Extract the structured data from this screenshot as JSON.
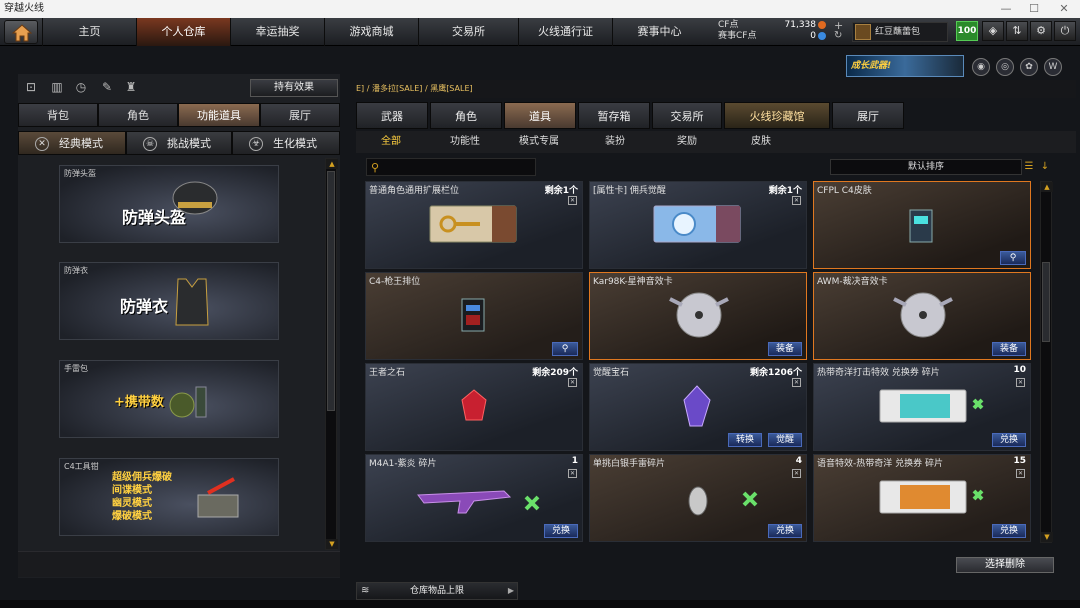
{
  "window": {
    "title": "穿越火线",
    "controls": [
      "—",
      "☐",
      "✕"
    ]
  },
  "topnav": {
    "tabs": [
      {
        "label": "主页"
      },
      {
        "label": "个人仓库"
      },
      {
        "label": "幸运抽奖"
      },
      {
        "label": "游戏商城"
      },
      {
        "label": "交易所"
      },
      {
        "label": "火线通行证"
      },
      {
        "label": "赛事中心"
      }
    ],
    "active": 1
  },
  "currency": {
    "cf_label": "CF点",
    "cf_value": "71,338",
    "event_label": "赛事CF点",
    "event_value": "0"
  },
  "pack": {
    "label": "红豆蘸蕾包"
  },
  "level": "100",
  "left": {
    "icons": [
      "box-off-icon",
      "chart-icon",
      "clock-icon",
      "tools-icon",
      "bag-icon"
    ],
    "effect_button": "持有效果",
    "tabs": [
      {
        "label": "背包"
      },
      {
        "label": "角色"
      },
      {
        "label": "功能道具"
      },
      {
        "label": "展厅"
      }
    ],
    "modes": [
      {
        "label": "经典模式"
      },
      {
        "label": "挑战模式"
      },
      {
        "label": "生化模式"
      }
    ],
    "cards": [
      {
        "tag": "防弹头盔",
        "big": "防弹头盔"
      },
      {
        "tag": "防弹衣",
        "big": "防弹衣"
      },
      {
        "tag": "手雷包",
        "big": "+携带数"
      },
      {
        "tag": "C4工具钳",
        "lines": [
          "超级佣兵爆破",
          "间谍模式",
          "幽灵模式",
          "爆破模式"
        ]
      }
    ]
  },
  "banner": {
    "text": "成长武器!"
  },
  "breadcrumb": "E] / 潘多拉[SALE] / 黑鹰[SALE]",
  "right": {
    "tabs": [
      {
        "label": "武器"
      },
      {
        "label": "角色"
      },
      {
        "label": "道具"
      },
      {
        "label": "暂存箱"
      },
      {
        "label": "交易所"
      },
      {
        "label": "火线珍藏馆"
      },
      {
        "label": "展厅"
      }
    ],
    "filters": [
      {
        "label": "全部"
      },
      {
        "label": "功能性"
      },
      {
        "label": "模式专属"
      },
      {
        "label": "装扮"
      },
      {
        "label": "奖励"
      },
      {
        "label": "皮肤"
      }
    ],
    "sort": "默认排序",
    "items": [
      {
        "name": "普通角色通用扩展栏位",
        "count": "剩余1个",
        "buttons": []
      },
      {
        "name": "[属性卡] 佣兵觉醒",
        "count": "剩余1个",
        "buttons": []
      },
      {
        "name": "CFPL C4皮肤",
        "count": "",
        "buttons": []
      },
      {
        "name": "C4-枪王排位",
        "count": "",
        "buttons": []
      },
      {
        "name": "Kar98K-星神音效卡",
        "count": "",
        "buttons": [
          "装备"
        ]
      },
      {
        "name": "AWM-裁决音效卡",
        "count": "",
        "buttons": [
          "装备"
        ]
      },
      {
        "name": "王者之石",
        "count": "剩余209个",
        "buttons": []
      },
      {
        "name": "觉醒宝石",
        "count": "剩余1206个",
        "buttons": [
          "转换",
          "觉醒"
        ]
      },
      {
        "name": "热带奇洋打击特效 兑换券 碎片",
        "count": "10",
        "buttons": [
          "兑换"
        ]
      },
      {
        "name": "M4A1-紫炎 碎片",
        "count": "1",
        "buttons": [
          "兑换"
        ]
      },
      {
        "name": "单挑白银手雷碎片",
        "count": "4",
        "buttons": [
          "兑换"
        ]
      },
      {
        "name": "语音特效-热带奇洋 兑换券 碎片",
        "count": "15",
        "buttons": [
          "兑换"
        ]
      }
    ],
    "delete_button": "选择删除",
    "capacity": "仓库物品上限"
  },
  "colors": {
    "accent": "#e07820",
    "gold": "#ffd040",
    "button_blue": "#3a5a9a"
  }
}
